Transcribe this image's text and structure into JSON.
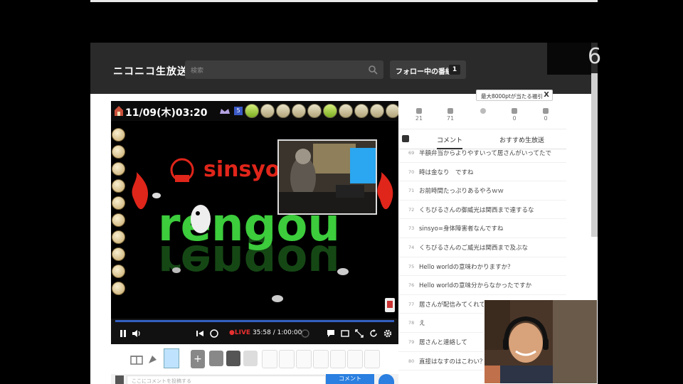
{
  "header": {
    "logo": "ニコニコ生放送",
    "search_placeholder": "検索",
    "follow_label": "フォロー中の番組",
    "follow_count": "1"
  },
  "side_number": "6",
  "player": {
    "datetime": "11/09(木)03:20",
    "level_badge": "5",
    "live_label": "LIVE",
    "elapsed": "35:58",
    "duration": "1:00:00",
    "progress": 0.6,
    "art_text_top": "sinsyo",
    "art_text_main": "rengou"
  },
  "stats": [
    {
      "icon": "viewer-icon",
      "value": "21"
    },
    {
      "icon": "comment-count-icon",
      "value": "71"
    },
    {
      "icon": "ad-icon",
      "value": ""
    },
    {
      "icon": "gift-point-icon",
      "value": "0"
    },
    {
      "icon": "gift-box-icon",
      "value": "0"
    }
  ],
  "tooltip": {
    "text": "最大8000ptが当たる福引",
    "close": "X"
  },
  "tabs": {
    "comments": "コメント",
    "recommended": "おすすめ生放送"
  },
  "comments": [
    {
      "no": "69",
      "text": "半額弁当からよりやすいって居さんがいってたで"
    },
    {
      "no": "70",
      "text": "時は金なり　ですね"
    },
    {
      "no": "71",
      "text": "お前時間たっぷりあるやろｗｗ"
    },
    {
      "no": "72",
      "text": "くちびるさんの御威光は関西まで達するな"
    },
    {
      "no": "73",
      "text": "sinsyo=身体障害者なんですね"
    },
    {
      "no": "74",
      "text": "くちびるさんのご威光は関西まで及ぶな"
    },
    {
      "no": "75",
      "text": "Hello worldの意味わかりますか？"
    },
    {
      "no": "76",
      "text": "Hello worldの意味分からなかったですか"
    },
    {
      "no": "77",
      "text": "居さんが配信みてくれてる"
    },
    {
      "no": "78",
      "text": "え"
    },
    {
      "no": "79",
      "text": "居さんと連絡して"
    },
    {
      "no": "80",
      "text": "直接はなすのはこわい？"
    }
  ],
  "comment_bar": {
    "placeholder": "ここにコメントを投稿する",
    "submit": "コメント"
  },
  "colors": {
    "accent": "#2a7fe0",
    "live": "#e83030",
    "art_green": "#3ccc3c",
    "art_red": "#e0251a"
  }
}
